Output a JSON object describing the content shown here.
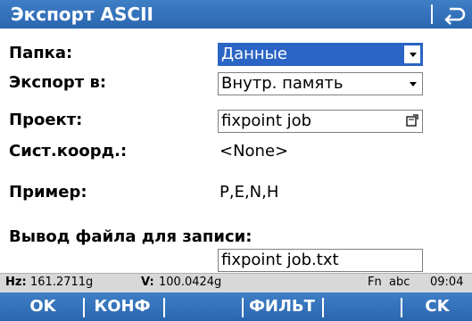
{
  "titlebar": {
    "title": "Экспорт ASCII",
    "back_icon": "back-arrow-icon"
  },
  "form": {
    "folder": {
      "label": "Папка:",
      "value": "Данные"
    },
    "export_to": {
      "label": "Экспорт в:",
      "value": "Внутр. память"
    },
    "project": {
      "label": "Проект:",
      "value": "fixpoint job"
    },
    "coord_system": {
      "label": "Сист.коорд.:",
      "value": "<None>"
    },
    "example": {
      "label": "Пример:",
      "value": "P,E,N,H"
    },
    "output_file": {
      "label": "Вывод файла для записи:",
      "value": "fixpoint job.txt"
    }
  },
  "statusbar": {
    "hz_label": "Hz:",
    "hz_value": "161.2711g",
    "v_label": "V:",
    "v_value": "100.0424g",
    "fn": "Fn",
    "input_mode": "abc",
    "time": "09:04"
  },
  "softkeys": {
    "f1": "OK",
    "f2": "КОНФ",
    "f3": "",
    "f4": "ФИЛЬТ",
    "f5": "",
    "f6": "CK"
  },
  "colors": {
    "bar_blue": "#2a66b0",
    "selection_blue": "#2a64c4",
    "status_gray": "#d8d8d8"
  }
}
